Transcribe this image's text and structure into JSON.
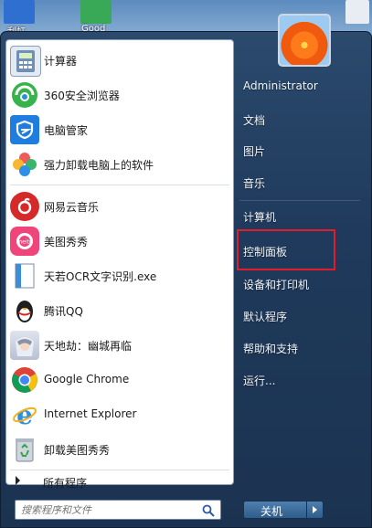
{
  "desktop": {
    "icons": [
      {
        "label": "刮虹",
        "color": "#2e6fd0"
      },
      {
        "label": "Good",
        "color": "#39a857"
      }
    ]
  },
  "programs": [
    {
      "label": "计算器",
      "icon": "calculator-icon",
      "color": "#5b7fa8"
    },
    {
      "label": "360安全浏览器",
      "icon": "360-browser-icon",
      "color": "#33b24a"
    },
    {
      "label": "电脑管家",
      "icon": "pc-manager-icon",
      "color": "#1f7de0"
    },
    {
      "label": "强力卸载电脑上的软件",
      "icon": "uninstaller-icon",
      "color": "#ef4a5b"
    },
    {
      "label": "网易云音乐",
      "icon": "netease-music-icon",
      "color": "#d42a2a"
    },
    {
      "label": "美图秀秀",
      "icon": "meitu-icon",
      "color": "#f0457a"
    },
    {
      "label": "天若OCR文字识别.exe",
      "icon": "ocr-exe-icon",
      "color": "#3b8fd8"
    },
    {
      "label": "腾讯QQ",
      "icon": "qq-penguin-icon",
      "color": "#222222"
    },
    {
      "label": "天地劫：幽城再临",
      "icon": "game-character-icon",
      "color": "#9aa3b8"
    },
    {
      "label": "Google Chrome",
      "icon": "chrome-icon",
      "color": "#db4437"
    },
    {
      "label": "Internet Explorer",
      "icon": "internet-explorer-icon",
      "color": "#2a8fe0"
    },
    {
      "label": "卸载美图秀秀",
      "icon": "recycle-bin-icon",
      "color": "#4aa55a"
    }
  ],
  "all_programs_label": "所有程序",
  "search": {
    "placeholder": "搜索程序和文件"
  },
  "right_items": [
    {
      "label": "Administrator"
    },
    {
      "label": "文档"
    },
    {
      "label": "图片"
    },
    {
      "label": "音乐"
    },
    {
      "label": "计算机"
    },
    {
      "label": "控制面板"
    },
    {
      "label": "设备和打印机"
    },
    {
      "label": "默认程序"
    },
    {
      "label": "帮助和支持"
    },
    {
      "label": "运行..."
    }
  ],
  "shutdown_label": "关机",
  "accent": {
    "highlight": "#e11d2a",
    "menu_bg": "#1f3a5c"
  }
}
